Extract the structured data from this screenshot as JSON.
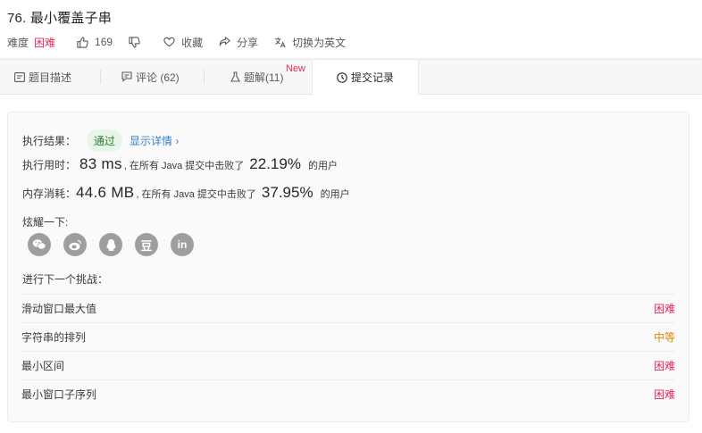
{
  "problem": {
    "title": "76. 最小覆盖子串",
    "difficulty_label": "难度",
    "difficulty": "困难",
    "likes": "169",
    "favorite_label": "收藏",
    "share_label": "分享",
    "translate_label": "切换为英文"
  },
  "tabs": [
    {
      "label": "题目描述"
    },
    {
      "label": "评论 (62)"
    },
    {
      "label": "题解(11)",
      "badge": "New"
    },
    {
      "label": "提交记录"
    }
  ],
  "result": {
    "label": "执行结果：",
    "status": "通过",
    "details_link": "显示详情 ›",
    "time_label": "执行用时：",
    "time_value": "83 ms",
    "time_mid": ", 在所有 Java 提交中击败了",
    "time_pct": "22.19%",
    "time_tail": "的用户",
    "mem_label": "内存消耗：",
    "mem_value": "44.6 MB",
    "mem_mid": ", 在所有 Java 提交中击败了",
    "mem_pct": "37.95%",
    "mem_tail": "的用户",
    "share_label": "炫耀一下:",
    "share_icons": [
      "wechat-icon",
      "weibo-icon",
      "qq-icon",
      "douban-icon",
      "linkedin-icon"
    ],
    "next_label": "进行下一个挑战："
  },
  "challenges": [
    {
      "name": "滑动窗口最大值",
      "difficulty": "困难",
      "level": "hard"
    },
    {
      "name": "字符串的排列",
      "difficulty": "中等",
      "level": "medium"
    },
    {
      "name": "最小区间",
      "difficulty": "困难",
      "level": "hard"
    },
    {
      "name": "最小窗口子序列",
      "difficulty": "困难",
      "level": "hard"
    }
  ],
  "colors": {
    "hard": "#e02f5b",
    "medium": "#d98b0b",
    "pass_bg": "#e7f6e8",
    "link": "#3b82c4"
  }
}
